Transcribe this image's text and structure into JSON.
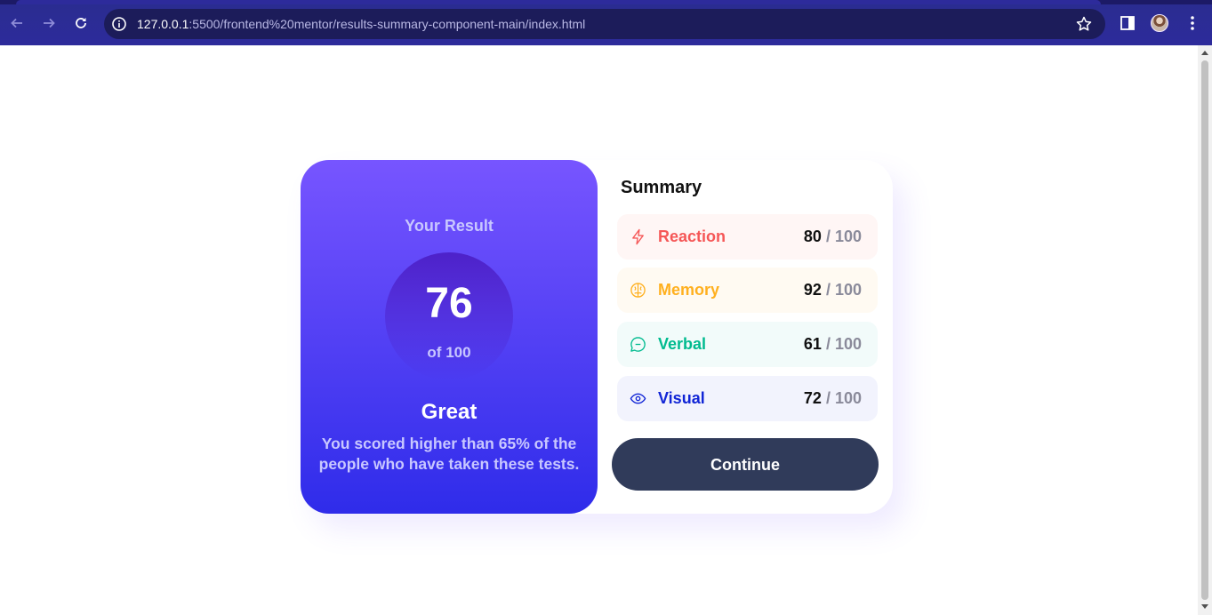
{
  "browser": {
    "url_host": "127.0.0.1",
    "url_rest": ":5500/frontend%20mentor/results-summary-component-main/index.html",
    "back_icon": "arrow-left-icon",
    "forward_icon": "arrow-right-icon",
    "reload_icon": "reload-icon",
    "info_icon": "info-icon",
    "bookmark_icon": "star-icon",
    "side_panel_icon": "side-panel-icon",
    "menu_icon": "kebab-menu-icon"
  },
  "result": {
    "heading": "Your Result",
    "score": "76",
    "of_total": "of 100",
    "rating": "Great",
    "description": "You scored higher than 65% of the people who have taken these tests."
  },
  "summary": {
    "title": "Summary",
    "items": [
      {
        "label": "Reaction",
        "score": "80",
        "max": " / 100",
        "icon": "lightning-icon",
        "color": "#f55757"
      },
      {
        "label": "Memory",
        "score": "92",
        "max": " / 100",
        "icon": "brain-icon",
        "color": "#ffb01f"
      },
      {
        "label": "Verbal",
        "score": "61",
        "max": " / 100",
        "icon": "chat-bubble-icon",
        "color": "#00bb8f"
      },
      {
        "label": "Visual",
        "score": "72",
        "max": " / 100",
        "icon": "eye-icon",
        "color": "#1125d6"
      }
    ],
    "continue_label": "Continue"
  },
  "colors": {
    "gradient_top": "#7755ff",
    "gradient_bottom": "#2f2cea",
    "button": "#303b5a"
  }
}
